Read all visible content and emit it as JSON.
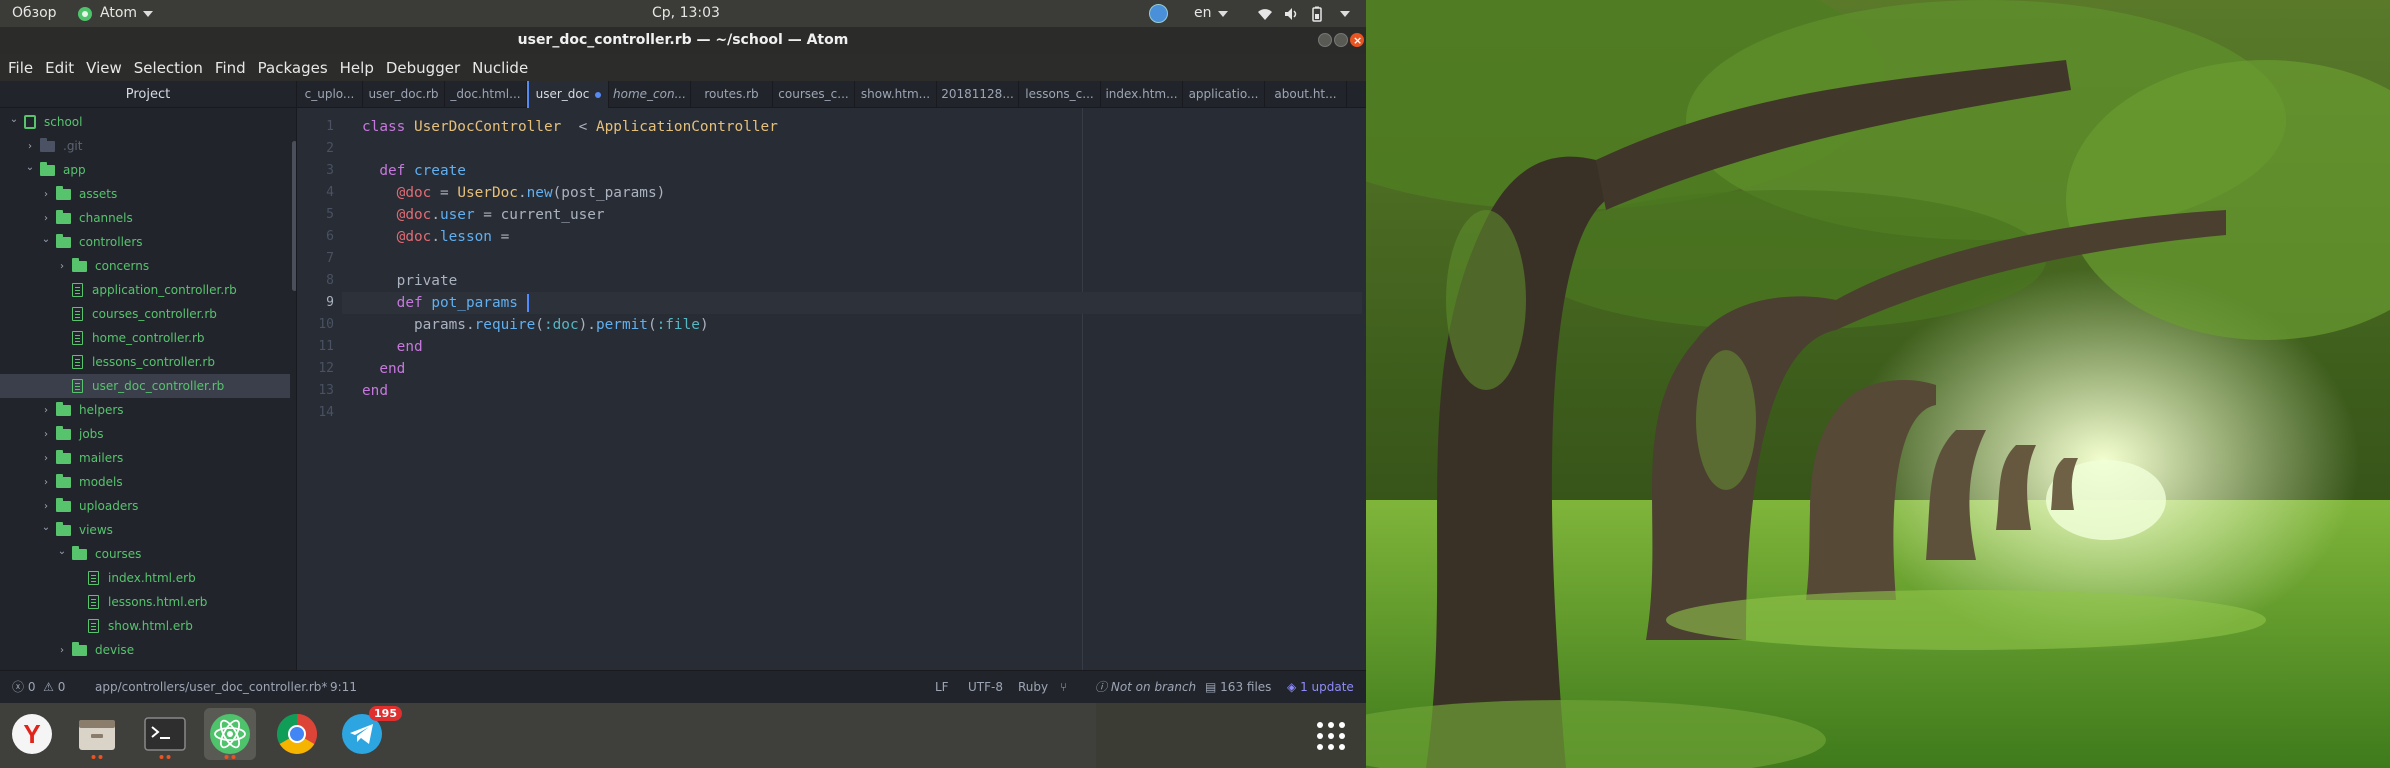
{
  "top_panel": {
    "activities": "Обзор",
    "app_name": "Atom",
    "clock": "Ср, 13:03",
    "keyboard_layout": "en"
  },
  "window": {
    "title": "user_doc_controller.rb — ~/school — Atom"
  },
  "menu": [
    "File",
    "Edit",
    "View",
    "Selection",
    "Find",
    "Packages",
    "Help",
    "Debugger",
    "Nuclide"
  ],
  "tree": {
    "header": "Project",
    "items": [
      {
        "label": "school",
        "kind": "repo",
        "open": true,
        "depth": 0
      },
      {
        "label": ".git",
        "kind": "folder-dim",
        "open": false,
        "depth": 1
      },
      {
        "label": "app",
        "kind": "folder",
        "open": true,
        "depth": 1
      },
      {
        "label": "assets",
        "kind": "folder",
        "open": false,
        "depth": 2
      },
      {
        "label": "channels",
        "kind": "folder",
        "open": false,
        "depth": 2
      },
      {
        "label": "controllers",
        "kind": "folder",
        "open": true,
        "depth": 2
      },
      {
        "label": "concerns",
        "kind": "folder",
        "open": false,
        "depth": 3
      },
      {
        "label": "application_controller.rb",
        "kind": "file",
        "depth": 3
      },
      {
        "label": "courses_controller.rb",
        "kind": "file",
        "depth": 3
      },
      {
        "label": "home_controller.rb",
        "kind": "file",
        "depth": 3
      },
      {
        "label": "lessons_controller.rb",
        "kind": "file",
        "depth": 3
      },
      {
        "label": "user_doc_controller.rb",
        "kind": "file",
        "depth": 3,
        "selected": true
      },
      {
        "label": "helpers",
        "kind": "folder",
        "open": false,
        "depth": 2
      },
      {
        "label": "jobs",
        "kind": "folder",
        "open": false,
        "depth": 2
      },
      {
        "label": "mailers",
        "kind": "folder",
        "open": false,
        "depth": 2
      },
      {
        "label": "models",
        "kind": "folder",
        "open": false,
        "depth": 2
      },
      {
        "label": "uploaders",
        "kind": "folder",
        "open": false,
        "depth": 2
      },
      {
        "label": "views",
        "kind": "folder",
        "open": true,
        "depth": 2
      },
      {
        "label": "courses",
        "kind": "folder",
        "open": true,
        "depth": 3
      },
      {
        "label": "index.html.erb",
        "kind": "file",
        "depth": 4
      },
      {
        "label": "lessons.html.erb",
        "kind": "file",
        "depth": 4
      },
      {
        "label": "show.html.erb",
        "kind": "file",
        "depth": 4
      },
      {
        "label": "devise",
        "kind": "folder",
        "open": false,
        "depth": 3
      }
    ]
  },
  "tabs": [
    {
      "label": "c_uplo...",
      "active": false
    },
    {
      "label": "user_doc.rb",
      "active": false
    },
    {
      "label": "_doc.html...",
      "active": false
    },
    {
      "label": "user_doc",
      "active": true,
      "modified": true
    },
    {
      "label": "home_con...",
      "active": false
    },
    {
      "label": "routes.rb",
      "active": false
    },
    {
      "label": "courses_c...",
      "active": false
    },
    {
      "label": "show.htm...",
      "active": false
    },
    {
      "label": "20181128...",
      "active": false
    },
    {
      "label": "lessons_c...",
      "active": false
    },
    {
      "label": "index.htm...",
      "active": false
    },
    {
      "label": "applicatio...",
      "active": false
    },
    {
      "label": "about.ht...",
      "active": false
    }
  ],
  "editor": {
    "current_line": 9,
    "lines": [
      [
        [
          "kw",
          "class "
        ],
        [
          "cls",
          "UserDocController"
        ],
        [
          "",
          "  < "
        ],
        [
          "cls",
          "ApplicationController"
        ]
      ],
      [],
      [
        [
          "",
          "  "
        ],
        [
          "kw",
          "def "
        ],
        [
          "fn",
          "create"
        ]
      ],
      [
        [
          "",
          "    "
        ],
        [
          "ivar",
          "@doc"
        ],
        [
          "",
          " = "
        ],
        [
          "cls",
          "UserDoc"
        ],
        [
          "",
          "."
        ],
        [
          "fn",
          "new"
        ],
        [
          "",
          "(post_params)"
        ]
      ],
      [
        [
          "",
          "    "
        ],
        [
          "ivar",
          "@doc"
        ],
        [
          "",
          "."
        ],
        [
          "fn",
          "user"
        ],
        [
          "",
          " = current_user"
        ]
      ],
      [
        [
          "",
          "    "
        ],
        [
          "ivar",
          "@doc"
        ],
        [
          "",
          "."
        ],
        [
          "fn",
          "lesson"
        ],
        [
          "",
          " = "
        ]
      ],
      [],
      [
        [
          "",
          "    private"
        ]
      ],
      [
        [
          "",
          "    "
        ],
        [
          "kw",
          "def "
        ],
        [
          "fn",
          "pot_params"
        ]
      ],
      [
        [
          "",
          "      params."
        ],
        [
          "fn",
          "require"
        ],
        [
          "",
          "("
        ],
        [
          "sym",
          ":doc"
        ],
        [
          "",
          ")."
        ],
        [
          "fn",
          "permit"
        ],
        [
          "",
          "("
        ],
        [
          "sym",
          ":file"
        ],
        [
          "",
          ")"
        ]
      ],
      [
        [
          "",
          "    "
        ],
        [
          "kw",
          "end"
        ]
      ],
      [
        [
          "",
          "  "
        ],
        [
          "kw",
          "end"
        ]
      ],
      [
        [
          "kw",
          "end"
        ]
      ],
      []
    ]
  },
  "status": {
    "errors": "0",
    "warnings": "0",
    "file_path": "app/controllers/user_doc_controller.rb*",
    "cursor": "9:11",
    "line_ending": "LF",
    "encoding": "UTF-8",
    "grammar": "Ruby",
    "branch": "Not on branch",
    "files": "163 files",
    "updates": "1 update"
  },
  "dock": {
    "telegram_badge": "195"
  },
  "colors": {
    "accent_blue": "#568af2",
    "tree_green": "#57c36d",
    "editor_bg": "#282c34",
    "ubuntu_orange": "#e95420"
  }
}
